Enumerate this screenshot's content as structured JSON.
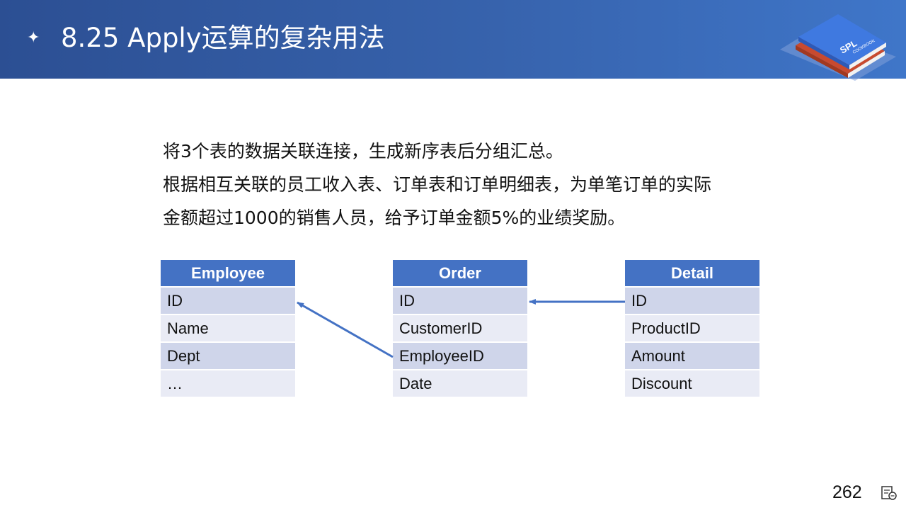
{
  "header": {
    "title": "8.25 Apply运算的复杂用法",
    "logo_text": "SPL",
    "logo_subtext": "COOKBOOK"
  },
  "description": [
    "将3个表的数据关联连接，生成新序表后分组汇总。",
    "根据相互关联的员工收入表、订单表和订单明细表，为单笔订单的实际",
    "金额超过1000的销售人员，给予订单金额5%的业绩奖励。"
  ],
  "tables": {
    "employee": {
      "title": "Employee",
      "fields": [
        "ID",
        "Name",
        "Dept",
        "…"
      ]
    },
    "order": {
      "title": "Order",
      "fields": [
        "ID",
        "CustomerID",
        "EmployeeID",
        "Date"
      ]
    },
    "detail": {
      "title": "Detail",
      "fields": [
        "ID",
        "ProductID",
        "Amount",
        "Discount"
      ]
    }
  },
  "footer": {
    "page_number": "262"
  },
  "colors": {
    "header_bg": "#2c4f93",
    "table_header": "#4472c4",
    "row_dark": "#cfd5ea",
    "row_light": "#e9ebf5",
    "arrow": "#4472c4"
  }
}
